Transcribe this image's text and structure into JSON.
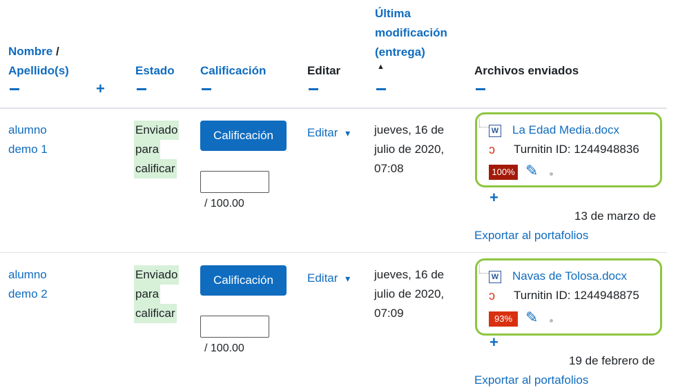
{
  "header": {
    "nombre": "Nombre",
    "nombre_sep": "/",
    "apellido": "Apellido(s)",
    "estado": "Estado",
    "calificacion": "Calificación",
    "editar": "Editar",
    "ultima_1": "Última",
    "ultima_2": "modificación",
    "ultima_3": "(entrega)",
    "sort_indicator": "▲",
    "archivos": "Archivos enviados",
    "collapse_symbol": "−",
    "expand_symbol": "+"
  },
  "rows": [
    {
      "name_1": "alumno",
      "name_2": "demo 1",
      "status_1": "Enviado",
      "status_2": "para",
      "status_3": "calificar",
      "grade_button": "Calificación",
      "grade_value": "",
      "grade_max": "/ 100.00",
      "edit_label": "Editar",
      "date_1": "jueves, 16 de",
      "date_2": "julio de 2020,",
      "date_3": "07:08",
      "file_name": "La Edad Media.docx",
      "turnitin": "Turnitin ID: 1244948836",
      "similarity": "100%",
      "similarity_color": "#a31a09",
      "plus": "+",
      "file_date": "13 de marzo de",
      "export": "Exportar al portafolios"
    },
    {
      "name_1": "alumno",
      "name_2": "demo 2",
      "status_1": "Enviado",
      "status_2": "para",
      "status_3": "calificar",
      "grade_button": "Calificación",
      "grade_value": "",
      "grade_max": "/ 100.00",
      "edit_label": "Editar",
      "date_1": "jueves, 16 de",
      "date_2": "julio de 2020,",
      "date_3": "07:09",
      "file_name": "Navas de Tolosa.docx",
      "turnitin": "Turnitin ID: 1244948875",
      "similarity": "93%",
      "similarity_color": "#d9300f",
      "plus": "+",
      "file_date": "19 de febrero de",
      "export": "Exportar al portafolios"
    }
  ],
  "icons": {
    "word": "W",
    "turnitin": "ↄ",
    "pencil": "✎",
    "caret": "▾"
  },
  "colors": {
    "link": "#0f6cbf",
    "status_bg": "#d7f0d8",
    "highlight_border": "#8dc63f"
  }
}
